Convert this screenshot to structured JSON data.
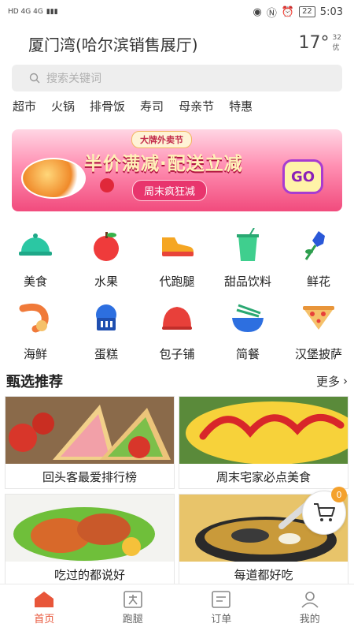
{
  "status_bar": {
    "network": "HD 4G 4G",
    "time": "5:03",
    "battery": "22"
  },
  "header": {
    "location": "厦门湾(哈尔滨销售展厅)",
    "temperature": "17°",
    "aqi_value": "32",
    "aqi_label": "优"
  },
  "search": {
    "placeholder": "搜索关键词"
  },
  "quick_tags": [
    "超市",
    "火锅",
    "排骨饭",
    "寿司",
    "母亲节",
    "特惠"
  ],
  "banner": {
    "tag": "大牌外卖节",
    "headline": "半价满减·配送立减",
    "subline": "周末疯狂减",
    "go": "GO"
  },
  "categories": [
    {
      "label": "美食",
      "icon": "cloche-icon"
    },
    {
      "label": "水果",
      "icon": "apple-icon"
    },
    {
      "label": "代跑腿",
      "icon": "shoe-icon"
    },
    {
      "label": "甜品饮料",
      "icon": "drink-icon"
    },
    {
      "label": "鲜花",
      "icon": "flower-icon"
    },
    {
      "label": "海鲜",
      "icon": "shrimp-icon"
    },
    {
      "label": "蛋糕",
      "icon": "cupcake-icon"
    },
    {
      "label": "包子铺",
      "icon": "bun-icon"
    },
    {
      "label": "简餐",
      "icon": "bowl-icon"
    },
    {
      "label": "汉堡披萨",
      "icon": "pizza-icon"
    }
  ],
  "featured": {
    "title": "甄选推荐",
    "more": "更多",
    "cards": [
      {
        "label": "回头客最爱排行榜"
      },
      {
        "label": "周末宅家必点美食"
      },
      {
        "label": "吃过的都说好"
      },
      {
        "label": "每道都好吃"
      }
    ]
  },
  "cart": {
    "count": "0"
  },
  "tabbar": [
    {
      "label": "首页",
      "active": true
    },
    {
      "label": "跑腿",
      "active": false
    },
    {
      "label": "订单",
      "active": false
    },
    {
      "label": "我的",
      "active": false
    }
  ],
  "colors": {
    "accent": "#e8563a",
    "banner_pink": "#f14b7d",
    "badge": "#f4a12c"
  }
}
